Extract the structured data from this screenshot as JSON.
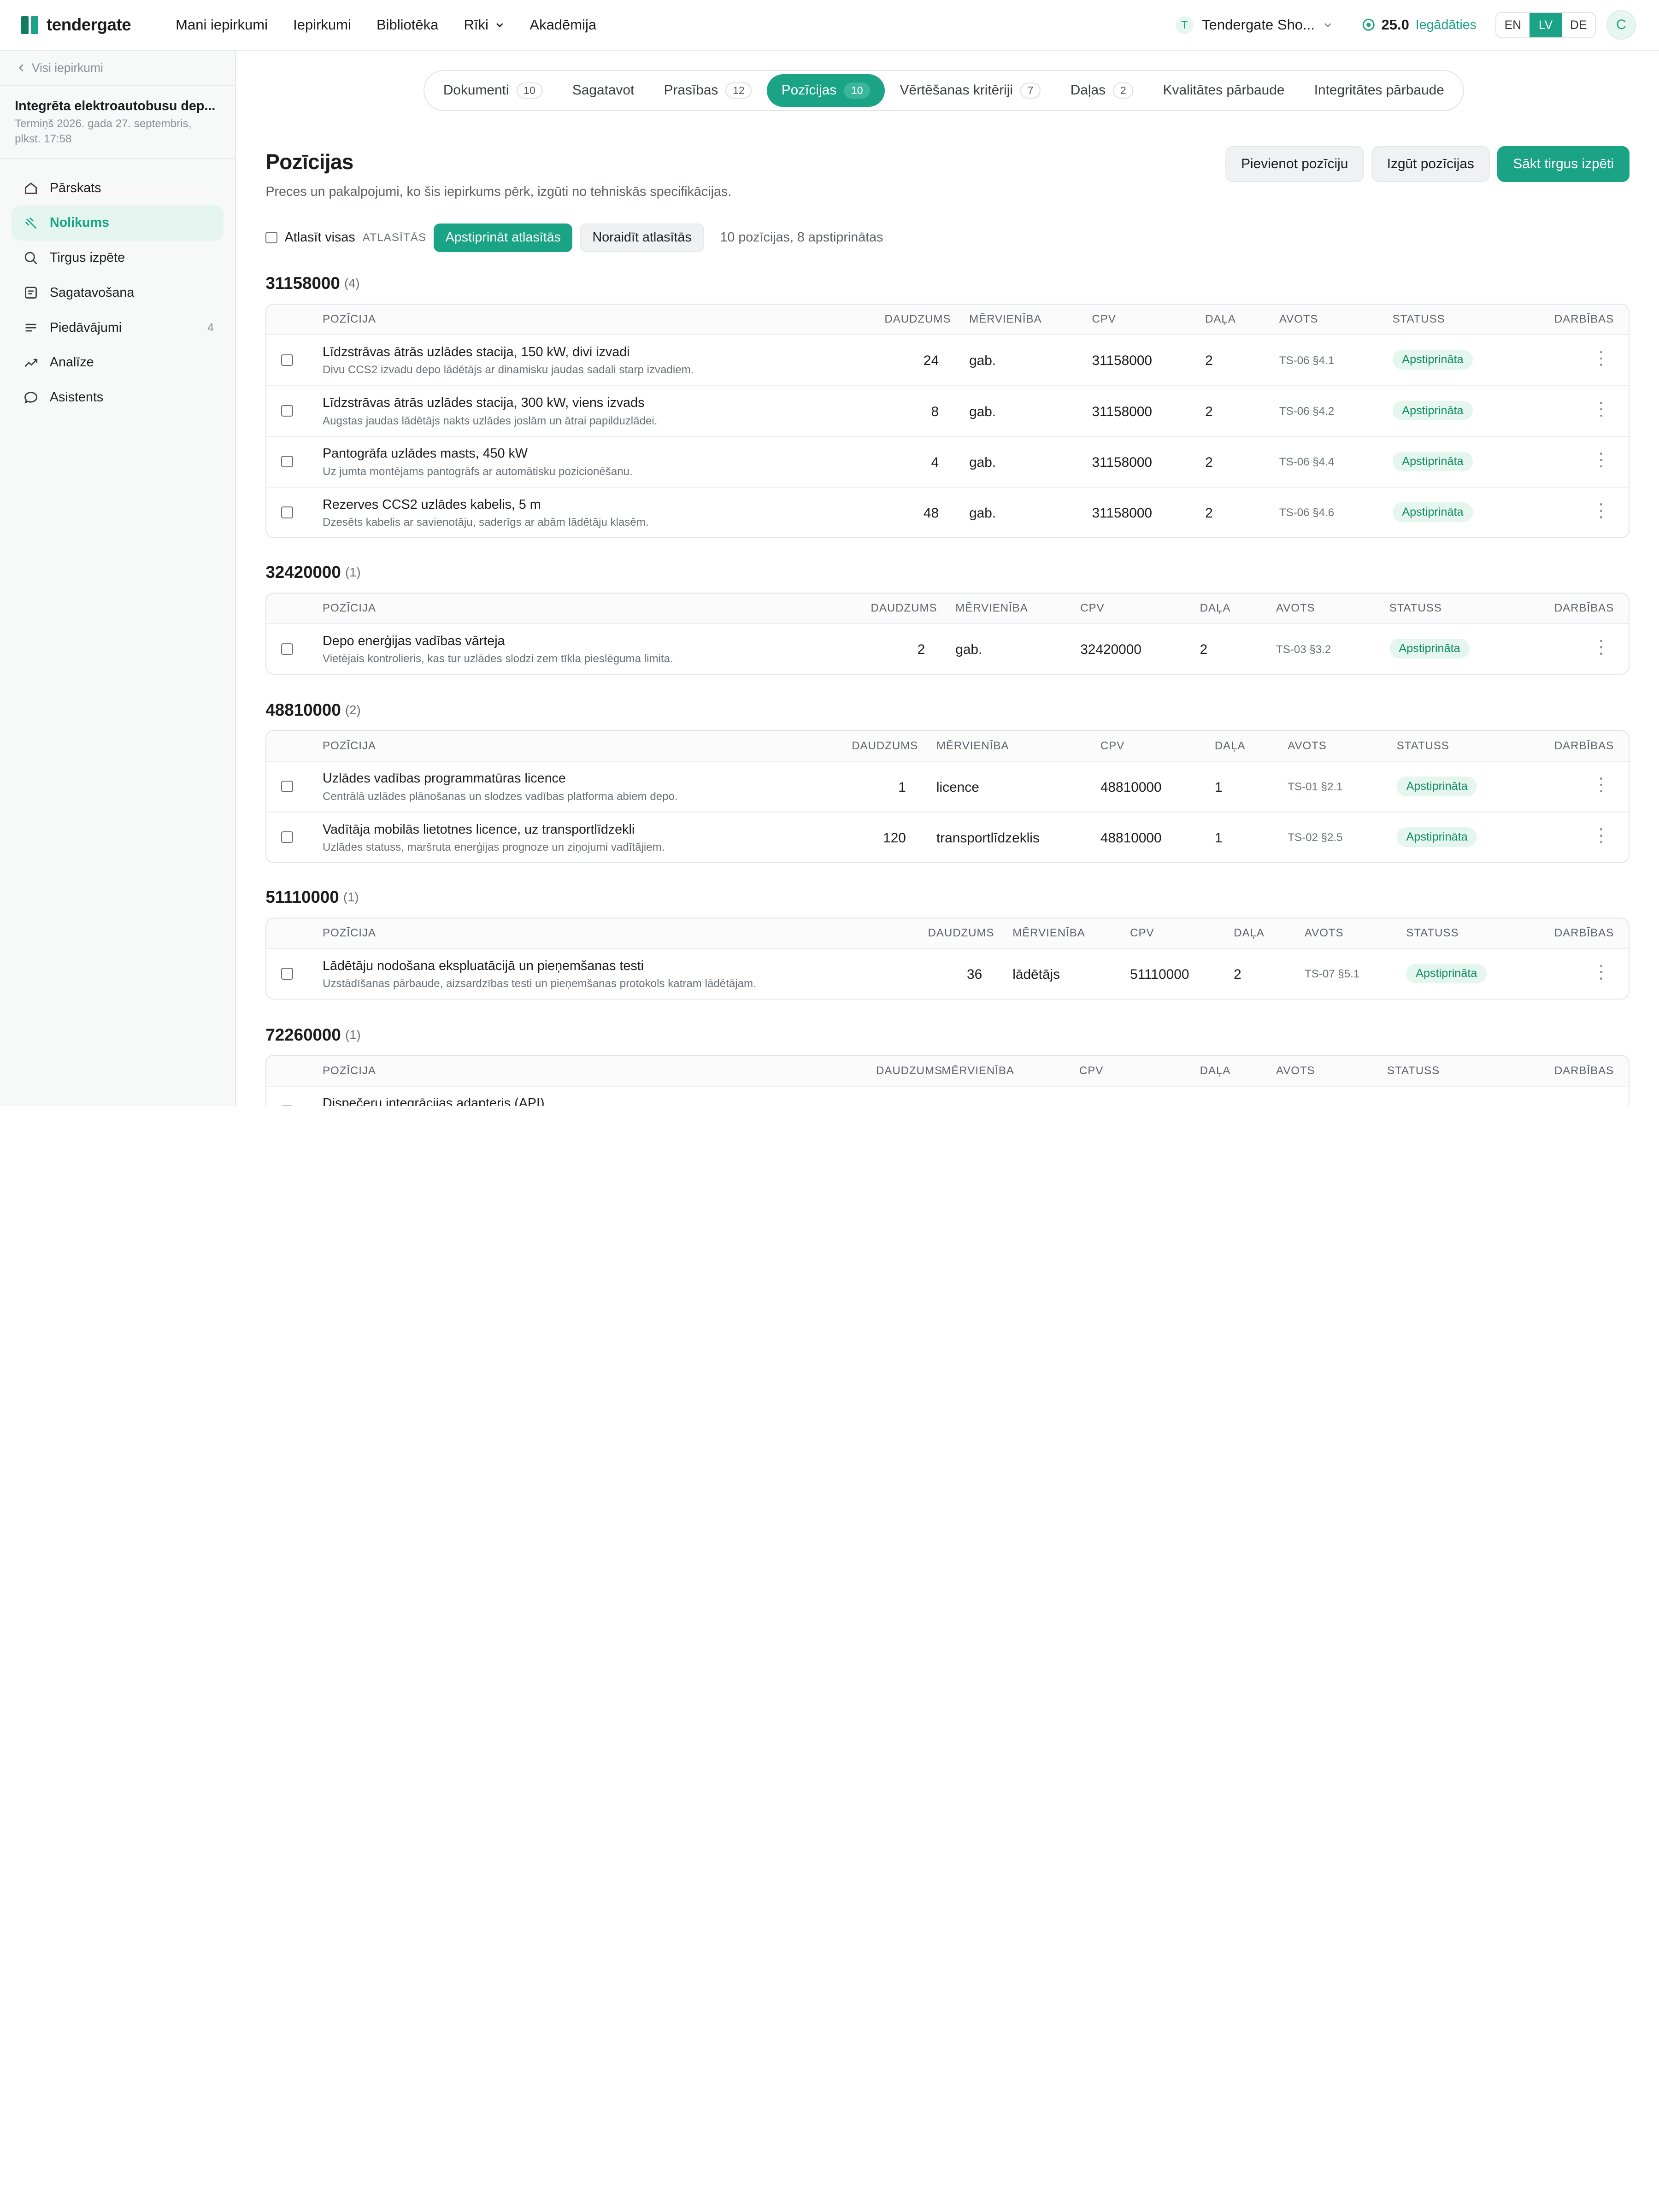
{
  "nav": {
    "logo": "tendergate",
    "items": [
      "Mani iepirkumi",
      "Iepirkumi",
      "Bibliotēka",
      "Rīki",
      "Akadēmija"
    ],
    "org_initial": "T",
    "org": "Tendergate Sho...",
    "credits": "25.0",
    "topup": "Iegādāties",
    "langs": [
      "EN",
      "LV",
      "DE"
    ],
    "active_lang": "LV",
    "user_initial": "C"
  },
  "sidebar": {
    "back": "Visi iepirkumi",
    "project_title": "Integrēta elektroautobusu dep...",
    "deadline": "Termiņš 2026. gada 27. septembris, plkst. 17:58",
    "items": [
      {
        "label": "Pārskats",
        "icon": "home-icon"
      },
      {
        "label": "Nolikums",
        "icon": "gavel-icon",
        "active": true
      },
      {
        "label": "Tirgus izpēte",
        "icon": "search-icon"
      },
      {
        "label": "Sagatavošana",
        "icon": "document-icon"
      },
      {
        "label": "Piedāvājumi",
        "icon": "list-icon",
        "count": "4"
      },
      {
        "label": "Analīze",
        "icon": "trend-icon"
      },
      {
        "label": "Asistents",
        "icon": "chat-icon"
      }
    ]
  },
  "tabs": [
    {
      "label": "Dokumenti",
      "badge": "10"
    },
    {
      "label": "Sagatavot"
    },
    {
      "label": "Prasības",
      "badge": "12"
    },
    {
      "label": "Pozīcijas",
      "badge": "10",
      "active": true
    },
    {
      "label": "Vērtēšanas kritēriji",
      "badge": "7"
    },
    {
      "label": "Daļas",
      "badge": "2"
    },
    {
      "label": "Kvalitātes pārbaude"
    },
    {
      "label": "Integritātes pārbaude"
    }
  ],
  "page": {
    "title": "Pozīcijas",
    "subtitle": "Preces un pakalpojumi, ko šis iepirkums pērk, izgūti no tehniskās specifikācijas.",
    "btn_add": "Pievienot pozīciju",
    "btn_extract": "Izgūt pozīcijas",
    "btn_market": "Sākt tirgus izpēti"
  },
  "selection": {
    "select_all": "Atlasīt visas",
    "caption": "ATLASĪTĀS",
    "approve": "Apstiprināt atlasītās",
    "reject": "Noraidīt atlasītās",
    "summary": "10 pozīcijas, 8 apstiprinātas"
  },
  "columns": {
    "pos": "POZĪCIJA",
    "qty": "DAUDZUMS",
    "unit": "MĒRVIENĪBA",
    "cpv": "CPV",
    "lot": "DAĻA",
    "src": "AVOTS",
    "status": "STATUSS",
    "actions": "DARBĪBAS"
  },
  "groups": [
    {
      "code": "31158000",
      "count": "(4)",
      "rows": [
        {
          "name": "Līdzstrāvas ātrās uzlādes stacija, 150 kW, divi izvadi",
          "desc": "Divu CCS2 izvadu depo lādētājs ar dinamisku jaudas sadali starp izvadiem.",
          "qty": "24",
          "unit": "gab.",
          "cpv": "31158000",
          "lot": "2",
          "src": "TS-06 §4.1",
          "status": "Apstiprināta"
        },
        {
          "name": "Līdzstrāvas ātrās uzlādes stacija, 300 kW, viens izvads",
          "desc": "Augstas jaudas lādētājs nakts uzlādes joslām un ātrai papildu­zlādei.",
          "qty": "8",
          "unit": "gab.",
          "cpv": "31158000",
          "lot": "2",
          "src": "TS-06 §4.2",
          "status": "Apstiprināta"
        },
        {
          "name": "Pantogrāfa uzlādes masts, 450 kW",
          "desc": "Uz jumta montējams pantogrāfs ar automātisku pozicionēšanu.",
          "qty": "4",
          "unit": "gab.",
          "cpv": "31158000",
          "lot": "2",
          "src": "TS-06 §4.4",
          "status": "Apstiprināta"
        },
        {
          "name": "Rezerves CCS2 uzlādes kabelis, 5 m",
          "desc": "Dzesēts kabelis ar savienotāju, saderīgs ar abām lādētāju klasēm.",
          "qty": "48",
          "unit": "gab.",
          "cpv": "31158000",
          "lot": "2",
          "src": "TS-06 §4.6",
          "status": "Apstiprināta"
        }
      ]
    },
    {
      "code": "32420000",
      "count": "(1)",
      "rows": [
        {
          "name": "Depo enerģijas vadības vārteja",
          "desc": "Vietējais kontrolieris, kas tur uzlādes slodzi zem tīkla pieslēguma limita.",
          "qty": "2",
          "unit": "gab.",
          "cpv": "32420000",
          "lot": "2",
          "src": "TS-03 §3.2",
          "status": "Apstiprināta"
        }
      ]
    },
    {
      "code": "48810000",
      "count": "(2)",
      "rows": [
        {
          "name": "Uzlādes vadības programmatūras licence",
          "desc": "Centrālā uzlādes plānošanas un slodzes vadības platforma abiem depo.",
          "qty": "1",
          "unit": "licence",
          "cpv": "48810000",
          "lot": "1",
          "src": "TS-01 §2.1",
          "status": "Apstiprināta"
        },
        {
          "name": "Vadītāja mobilās lietotnes licence, uz transportlīdzekli",
          "desc": "Uzlādes statuss, maršruta enerģijas prognoze un ziņojumi vadītājiem.",
          "qty": "120",
          "unit": "transportlīdzeklis",
          "cpv": "48810000",
          "lot": "1",
          "src": "TS-02 §2.5",
          "status": "Apstiprināta"
        }
      ]
    },
    {
      "code": "51110000",
      "count": "(1)",
      "rows": [
        {
          "name": "Lādētāju nodošana ekspluatācijā un pieņemšanas testi",
          "desc": "Uzstādīšanas pārbaude, aizsardzības testi un pieņemšanas protokols katram lādētājam.",
          "qty": "36",
          "unit": "lādētājs",
          "cpv": "51110000",
          "lot": "2",
          "src": "TS-07 §5.1",
          "status": "Apstiprināta"
        }
      ]
    },
    {
      "code": "72260000",
      "count": "(1)",
      "rows": [
        {
          "name": "Dispečeru integrācijas adapteris (API)",
          "desc": "",
          "qty": "",
          "unit": "",
          "cpv": "",
          "lot": "",
          "src": "",
          "status": ""
        }
      ]
    }
  ]
}
